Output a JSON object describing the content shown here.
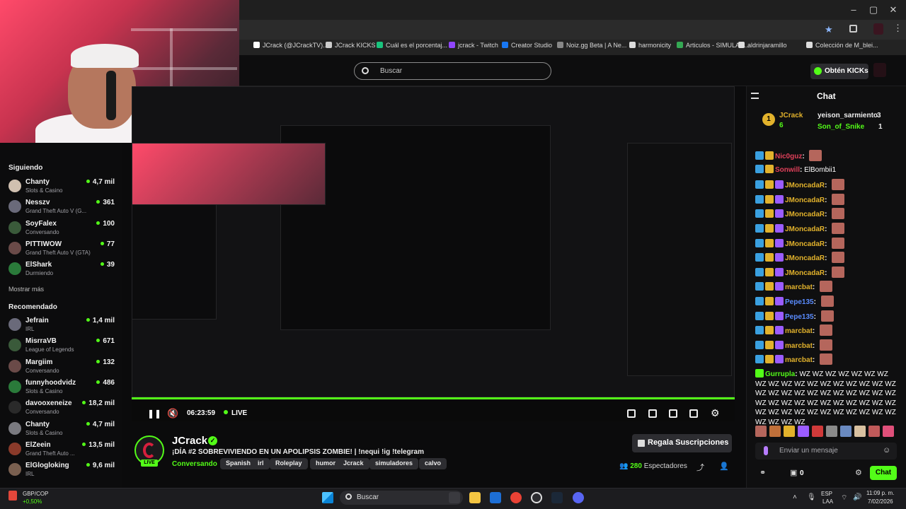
{
  "browser": {
    "bookmarks": [
      {
        "label": "JCrack (@JCrackTV)...",
        "color": "#ffffff"
      },
      {
        "label": "JCrack KICKS",
        "color": "#cccccc"
      },
      {
        "label": "Cuál es el porcentaj...",
        "color": "#19c37d"
      },
      {
        "label": "jcrack - Twitch",
        "color": "#9146ff"
      },
      {
        "label": "Creator Studio",
        "color": "#1877f2"
      },
      {
        "label": "Noiz.gg Beta | A Ne...",
        "color": "#888888"
      },
      {
        "label": "harmonicity",
        "color": "#dddddd"
      },
      {
        "label": "Articulos - SIMULAC...",
        "color": "#34a853"
      },
      {
        "label": "aldrinjaramillo",
        "color": "#dddddd"
      },
      {
        "label": "Colección de M_blei...",
        "color": "#dddddd"
      }
    ]
  },
  "header": {
    "search_placeholder": "Buscar",
    "kicks_button": "Obtén KICKs"
  },
  "sidebar": {
    "following_title": "Siguiendo",
    "following": [
      {
        "name": "Chanty",
        "category": "Slots & Casino",
        "viewers": "4,7 mil"
      },
      {
        "name": "Nesszv",
        "category": "Grand Theft Auto V (G...",
        "viewers": "361"
      },
      {
        "name": "SoyFalex",
        "category": "Conversando",
        "viewers": "100"
      },
      {
        "name": "PITTIWOW",
        "category": "Grand Theft Auto V (GTA)",
        "viewers": "77"
      },
      {
        "name": "ElShark",
        "category": "Durmiendo",
        "viewers": "39"
      }
    ],
    "show_more": "Mostrar más",
    "recommended_title": "Recomendado",
    "recommended": [
      {
        "name": "Jefrain",
        "category": "IRL",
        "viewers": "1,4 mil"
      },
      {
        "name": "MisrraVB",
        "category": "League of Legends",
        "viewers": "671"
      },
      {
        "name": "Margiim",
        "category": "Conversando",
        "viewers": "132"
      },
      {
        "name": "funnyhoodvidz",
        "category": "Slots & Casino",
        "viewers": "486"
      },
      {
        "name": "davooxeneize",
        "category": "Conversando",
        "viewers": "18,2 mil"
      },
      {
        "name": "Chanty",
        "category": "Slots & Casino",
        "viewers": "4,7 mil"
      },
      {
        "name": "ElZeein",
        "category": "Grand Theft Auto ...",
        "viewers": "13,5 mil"
      },
      {
        "name": "ElGlogloking",
        "category": "IRL",
        "viewers": "9,6 mil"
      }
    ]
  },
  "player": {
    "time": "06:23:59",
    "live": "LIVE",
    "progress_fraction": 1.0
  },
  "stream": {
    "streamer": "JCrack",
    "live_tag": "LIVE",
    "title": "¡DÍA #2 SOBREVIVIENDO EN UN APOLIPSIS ZOMBIE! |  !nequi !ig !telegram",
    "category": "Conversando",
    "tags": [
      "Spanish",
      "irl",
      "Roleplay",
      "humor",
      "Jcrack",
      "simuladores",
      "calvo"
    ],
    "subscribe_button": "Regala Suscripciones",
    "viewers_count": "280",
    "viewers_label": "Espectadores"
  },
  "chat": {
    "title": "Chat",
    "donors": [
      {
        "name": "JCrack",
        "amount": "6"
      },
      {
        "name": "yeison_sarmiento",
        "amount": "3"
      },
      {
        "name": "Son_of_Snike",
        "amount": "1"
      }
    ],
    "messages": [
      {
        "user": "Nic0guz",
        "text": "",
        "color": "#e0405a",
        "emotes": 1
      },
      {
        "user": "Sonwill",
        "text": "ElBombii1",
        "color": "#e0405a",
        "emotes": 0
      },
      {
        "user": "JMoncadaR",
        "text": "",
        "color": "#e2b22c",
        "emotes": 1
      },
      {
        "user": "JMoncadaR",
        "text": "",
        "color": "#e2b22c",
        "emotes": 1
      },
      {
        "user": "JMoncadaR",
        "text": "",
        "color": "#e2b22c",
        "emotes": 1
      },
      {
        "user": "JMoncadaR",
        "text": "",
        "color": "#e2b22c",
        "emotes": 1
      },
      {
        "user": "JMoncadaR",
        "text": "",
        "color": "#e2b22c",
        "emotes": 1
      },
      {
        "user": "JMoncadaR",
        "text": "",
        "color": "#e2b22c",
        "emotes": 1
      },
      {
        "user": "JMoncadaR",
        "text": "",
        "color": "#e2b22c",
        "emotes": 1
      },
      {
        "user": "marcbat",
        "text": "",
        "color": "#e2b22c",
        "emotes": 1
      },
      {
        "user": "Pepe135",
        "text": "",
        "color": "#5a8cff",
        "emotes": 1
      },
      {
        "user": "Pepe135",
        "text": "",
        "color": "#5a8cff",
        "emotes": 1
      },
      {
        "user": "marcbat",
        "text": "",
        "color": "#e2b22c",
        "emotes": 1
      },
      {
        "user": "marcbat",
        "text": "",
        "color": "#e2b22c",
        "emotes": 1
      },
      {
        "user": "marcbat",
        "text": "",
        "color": "#e2b22c",
        "emotes": 1
      }
    ],
    "last_message": {
      "user": "Gurrupla",
      "text": "WZ WZ WZ WZ WZ WZ WZ WZ WZ WZ WZ WZ WZ WZ WZ WZ WZ WZ WZ WZ WZ WZ WZ WZ WZ WZ WZ WZ WZ WZ WZ WZ WZ WZ WZ WZ WZ WZ WZ WZ WZ WZ WZ WZ WZ WZ WZ WZ WZ WZ WZ WZ WZ WZ WZ",
      "color": "#53fc18"
    },
    "input_placeholder": "Enviar un mensaje",
    "points": "0",
    "chat_button": "Chat"
  },
  "taskbar": {
    "search": "Buscar",
    "currency": "GBP/COP",
    "currency_change": "+0,50%",
    "lang": "ESP",
    "lang2": "LAA",
    "time": "11:09 p. m.",
    "date": "7/02/2026"
  }
}
